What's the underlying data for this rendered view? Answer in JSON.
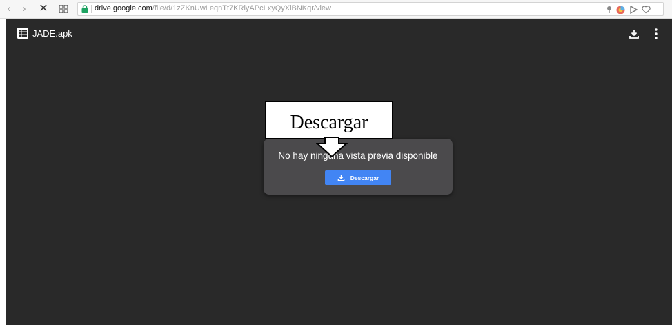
{
  "browser": {
    "url_host": "drive.google.com",
    "url_path": "/file/d/1zZKnUwLeqnTt7KRlyAPcLxyQyXiBNKqr/view",
    "nav_icons": [
      "back-icon",
      "forward-icon",
      "close-icon",
      "grid-icon"
    ],
    "extension_icons": [
      "pin-icon",
      "extension-icon",
      "play-icon",
      "heart-icon"
    ]
  },
  "viewer": {
    "file_name": "JADE.apk",
    "file_icon": "spreadsheet-icon",
    "top_actions": [
      "download-icon",
      "more-vert-icon"
    ]
  },
  "dialog": {
    "message": "No hay ninguna vista previa disponible",
    "button_label": "Descargar"
  },
  "annotation": {
    "label": "Descargar"
  },
  "colors": {
    "viewer_bg": "#292929",
    "dialog_bg": "#4b4a4c",
    "button_bg": "#4285f4",
    "lock_green": "#1ea362"
  }
}
